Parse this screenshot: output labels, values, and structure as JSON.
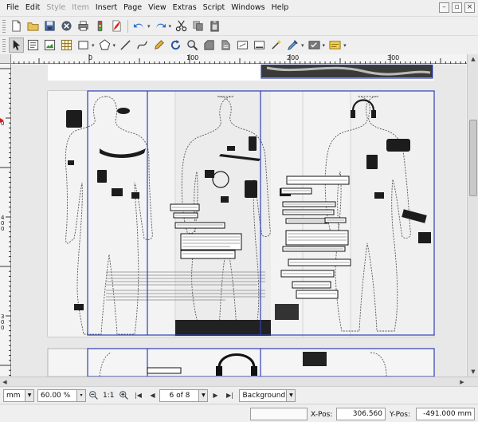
{
  "menubar": {
    "items": [
      {
        "label": "File",
        "enabled": true
      },
      {
        "label": "Edit",
        "enabled": true
      },
      {
        "label": "Style",
        "enabled": false
      },
      {
        "label": "Item",
        "enabled": false
      },
      {
        "label": "Insert",
        "enabled": true
      },
      {
        "label": "Page",
        "enabled": true
      },
      {
        "label": "View",
        "enabled": true
      },
      {
        "label": "Extras",
        "enabled": true
      },
      {
        "label": "Script",
        "enabled": true
      },
      {
        "label": "Windows",
        "enabled": true
      },
      {
        "label": "Help",
        "enabled": true
      }
    ]
  },
  "ruler": {
    "top_labels": [
      "0",
      "100",
      "200",
      "300"
    ],
    "left_labels": [
      "0",
      "400",
      "300"
    ]
  },
  "navigation": {
    "unit": "mm",
    "zoom": "60.00 %",
    "zoom_ratio": "1:1",
    "page_indicator": "6 of 8",
    "layer": "Background"
  },
  "status": {
    "x_label": "X-Pos:",
    "x_value": "306.560 mm",
    "y_label": "Y-Pos:",
    "y_value": "-491.000 mm"
  },
  "colors": {
    "frame_border": "#2f3fb8",
    "paper": "#ffffff",
    "canvas": "#e8e8e8"
  }
}
